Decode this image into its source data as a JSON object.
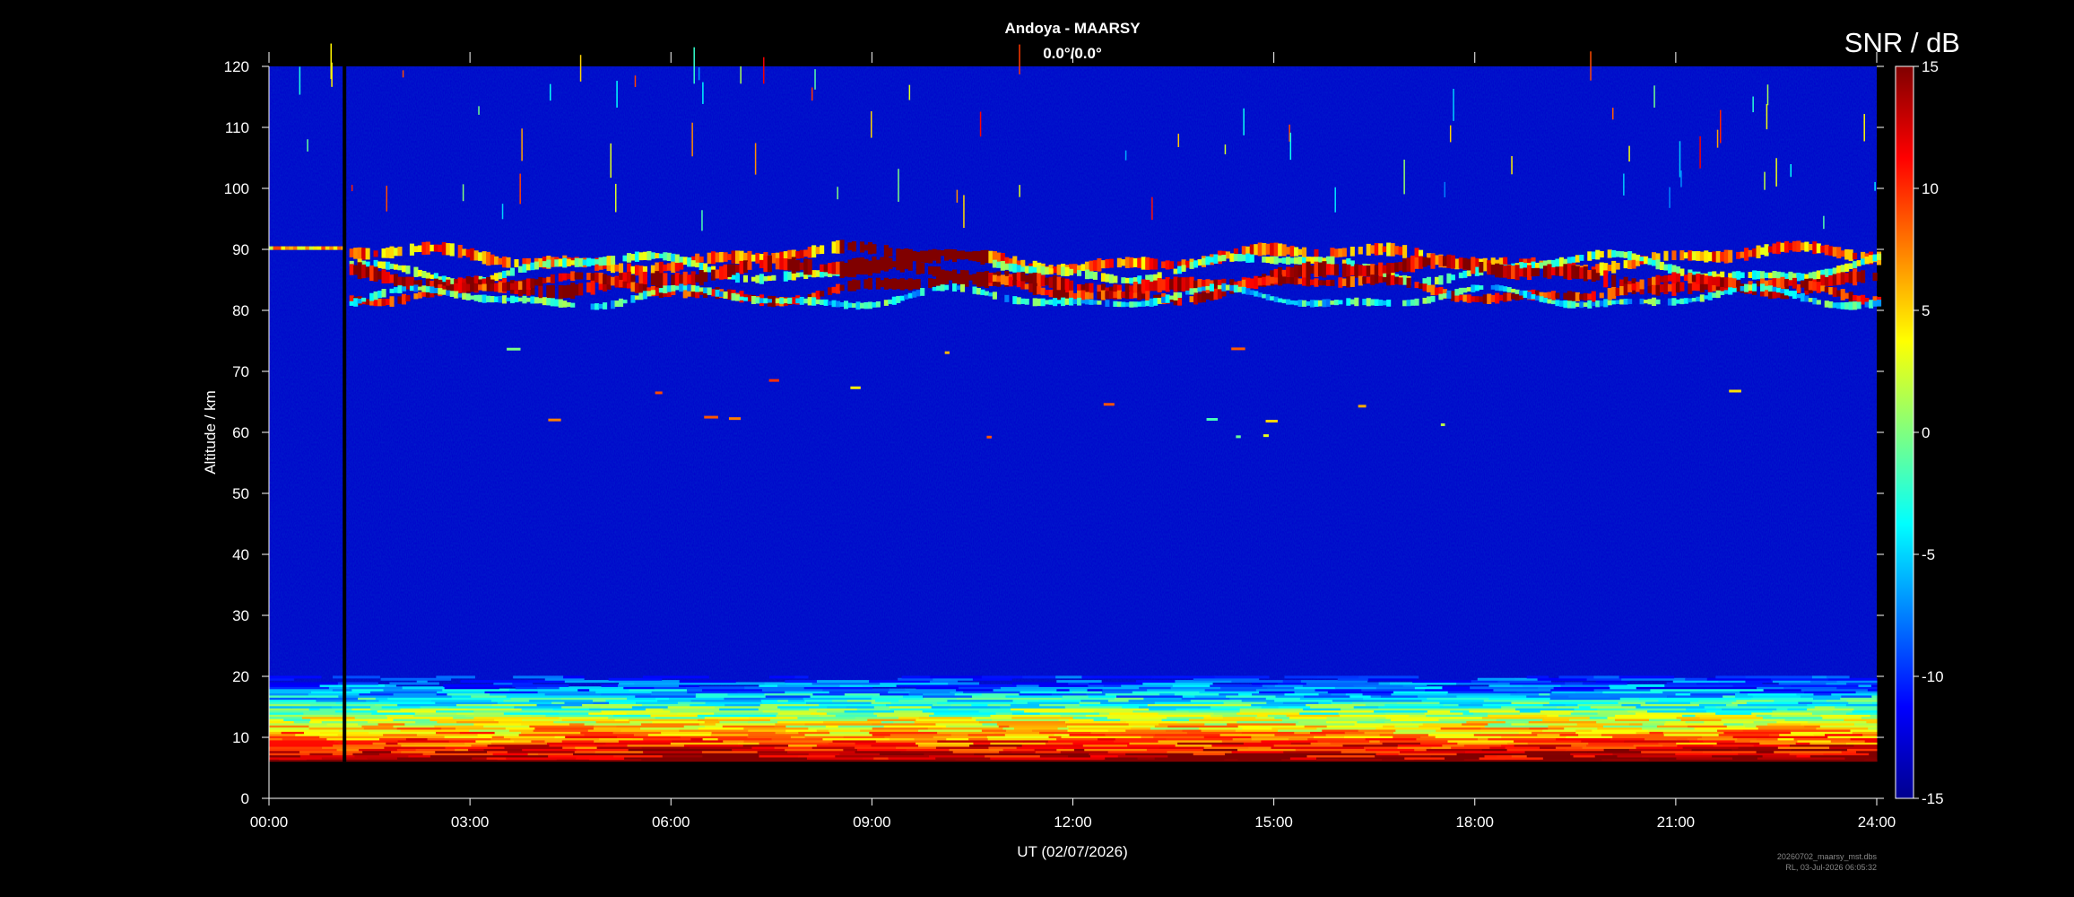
{
  "chart_data": {
    "type": "heatmap",
    "title": "Andoya - MAARSY",
    "subtitle": "0.0°/0.0°",
    "xlabel": "UT (02/07/2026)",
    "ylabel": "Altitude / km",
    "xlim": [
      0,
      24
    ],
    "ylim": [
      0,
      120
    ],
    "x_ticks": [
      "00:00",
      "03:00",
      "06:00",
      "09:00",
      "12:00",
      "15:00",
      "18:00",
      "21:00",
      "24:00"
    ],
    "y_ticks": [
      0,
      10,
      20,
      30,
      40,
      50,
      60,
      70,
      80,
      90,
      100,
      110,
      120
    ],
    "colorbar": {
      "label": "SNR / dB",
      "range": [
        -15,
        15
      ],
      "ticks": [
        15,
        10,
        5,
        0,
        -5,
        -10,
        -15
      ],
      "colormap": "jet"
    },
    "data_gap": {
      "start_hour": 1.1,
      "end_hour": 1.15
    },
    "no_data_below_km": 6,
    "layers": [
      {
        "name": "pmse",
        "altitude_range_km": [
          80,
          92
        ],
        "snr_db_max": 15
      },
      {
        "name": "troposphere",
        "altitude_range_km": [
          6,
          20
        ],
        "snr_db_max": 15
      },
      {
        "name": "background",
        "snr_db": -13
      }
    ]
  },
  "footer": {
    "line1": "20260702_maarsy_mst.dbs",
    "line2": "RL, 03-Jul-2026 06:05:32"
  }
}
